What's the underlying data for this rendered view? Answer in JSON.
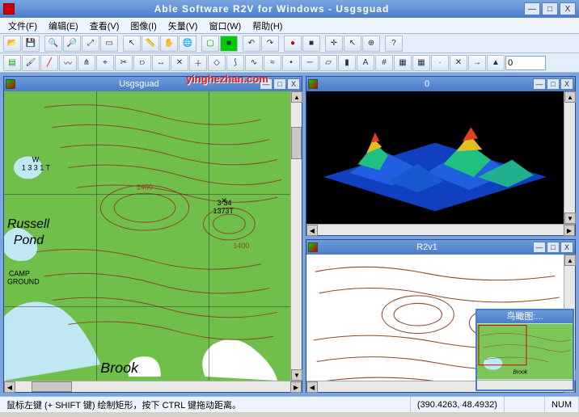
{
  "app": {
    "title": "Able Software R2V for Windows - Usgsguad",
    "min": "—",
    "max": "□",
    "close": "X"
  },
  "menu": {
    "file": "文件(F)",
    "edit": "编辑(E)",
    "view": "查看(V)",
    "image": "图像(I)",
    "vector": "矢量(V)",
    "window": "窗口(W)",
    "help": "帮助(H)"
  },
  "toolbar3_input": "0",
  "watermark": "yinghezhan.com",
  "panel_map": {
    "title": "Usgsguad"
  },
  "panel_3d": {
    "title": "0"
  },
  "panel_vec": {
    "title": "R2v1"
  },
  "birdseye": {
    "title": "鸟瞰图:..."
  },
  "map_labels": {
    "tower": "W\n1 3 3 1 T",
    "russell": "Russell",
    "pond": "Pond",
    "camp": "CAMP\nGROUND",
    "brook": "Brook",
    "elev1400a": "1400",
    "elev1400b": "1400",
    "spot": "3·34\n1373T"
  },
  "statusbar": {
    "hint": "鼠标左键 (+ SHIFT 键) 绘制矩形，按下 CTRL 键拖动距离。",
    "coords": "(390.4263, 48.4932)",
    "mode": "NUM"
  }
}
